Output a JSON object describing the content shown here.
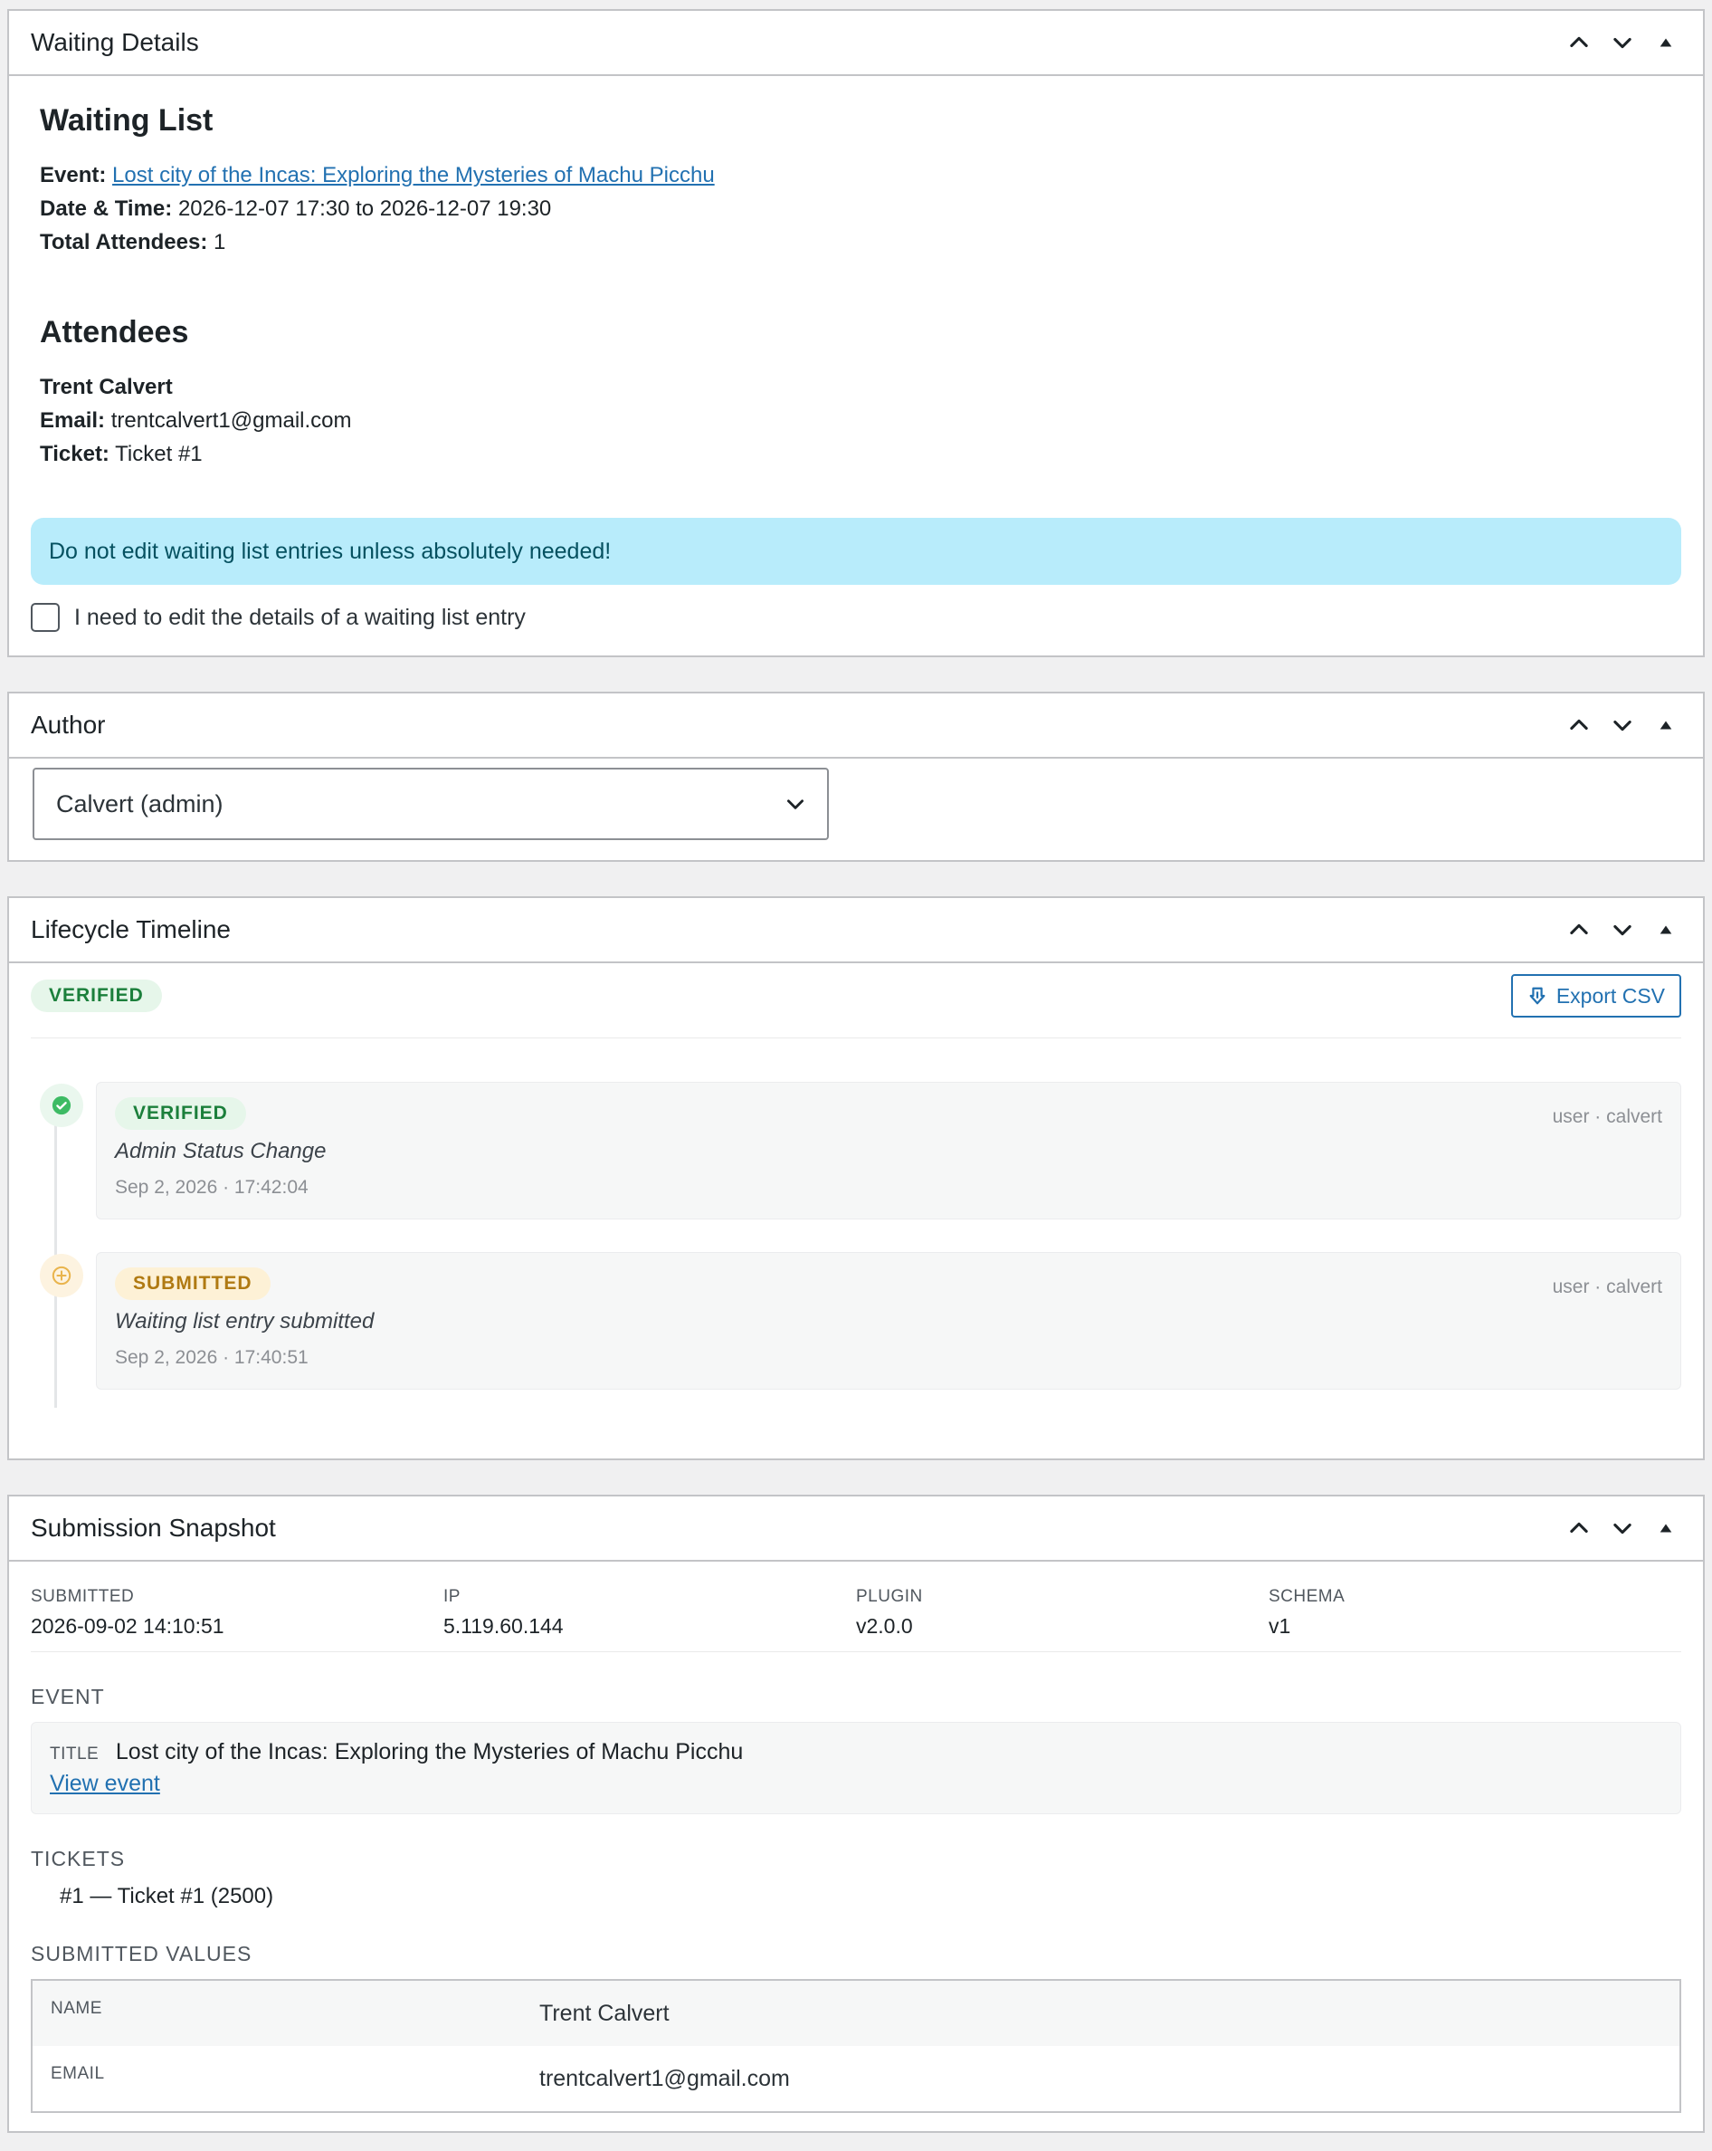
{
  "waiting_details": {
    "title": "Waiting Details",
    "heading": "Waiting List",
    "event_label": "Event:",
    "event_title": "Lost city of the Incas: Exploring the Mysteries of Machu Picchu",
    "datetime_label": "Date & Time:",
    "datetime_value": "2026-12-07 17:30 to 2026-12-07 19:30",
    "attendees_label": "Total Attendees:",
    "attendees_value": "1",
    "attendees_heading": "Attendees",
    "attendee_name": "Trent Calvert",
    "email_label": "Email:",
    "email_value": "trentcalvert1@gmail.com",
    "ticket_label": "Ticket:",
    "ticket_value": "Ticket #1",
    "alert": "Do not edit waiting list entries unless absolutely needed!",
    "checkbox_label": "I need to edit the details of a waiting list entry"
  },
  "author": {
    "title": "Author",
    "selected": "Calvert (admin)"
  },
  "lifecycle": {
    "title": "Lifecycle Timeline",
    "current_status": "VERIFIED",
    "export_label": "Export CSV",
    "items": [
      {
        "status": "VERIFIED",
        "description": "Admin Status Change",
        "timestamp": "Sep 2, 2026 · 17:42:04",
        "actor": "user · calvert"
      },
      {
        "status": "SUBMITTED",
        "description": "Waiting list entry submitted",
        "timestamp": "Sep 2, 2026 · 17:40:51",
        "actor": "user · calvert"
      }
    ]
  },
  "snapshot": {
    "title": "Submission Snapshot",
    "meta": [
      {
        "key": "SUBMITTED",
        "value": "2026-09-02 14:10:51"
      },
      {
        "key": "IP",
        "value": "5.119.60.144"
      },
      {
        "key": "PLUGIN",
        "value": "v2.0.0"
      },
      {
        "key": "SCHEMA",
        "value": "v1"
      }
    ],
    "event_heading": "EVENT",
    "title_key": "TITLE",
    "event_title": "Lost city of the Incas: Exploring the Mysteries of Machu Picchu",
    "view_event": "View event",
    "tickets_heading": "TICKETS",
    "ticket_line": "#1 — Ticket #1 (2500)",
    "values_heading": "SUBMITTED VALUES",
    "values": [
      {
        "key": "NAME",
        "value": "Trent Calvert"
      },
      {
        "key": "EMAIL",
        "value": "trentcalvert1@gmail.com"
      }
    ]
  }
}
